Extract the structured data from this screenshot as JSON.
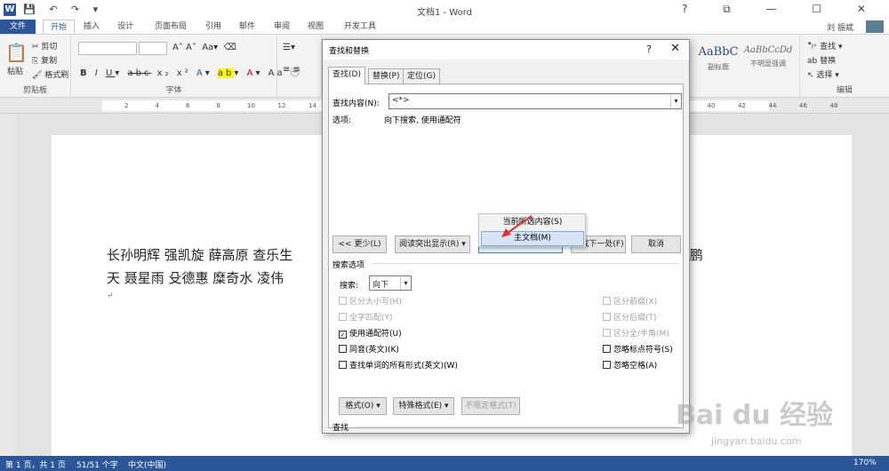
{
  "titlebar": {
    "title": "文档1 - Word",
    "app_icon": "W",
    "quick_access": [
      "save-icon",
      "undo-icon",
      "redo-icon",
      "customize-icon"
    ],
    "window_controls": [
      "?",
      "⧉",
      "—",
      "☐",
      "✕"
    ]
  },
  "tabs": [
    "文件",
    "开始",
    "插入",
    "设计",
    "页面布局",
    "引用",
    "邮件",
    "审阅",
    "视图",
    "开发工具"
  ],
  "user_name": "刘 振斌",
  "ribbon": {
    "clipboard": {
      "paste": "粘贴",
      "cut": "剪切",
      "copy": "复制",
      "format_painter": "格式刷",
      "label": "剪贴板"
    },
    "font": {
      "label": "字体",
      "buttons": [
        "B",
        "I",
        "U",
        "abc",
        "x₂",
        "x²",
        "A",
        "A",
        "Aa",
        "wén",
        "A"
      ]
    },
    "styles": [
      {
        "sample": "AaBbC",
        "name": "副标题"
      },
      {
        "sample": "AaBbCcDd",
        "name": "不明显强调"
      }
    ],
    "editing": {
      "find": "查找",
      "replace": "替换",
      "select": "选择",
      "label": "编辑"
    }
  },
  "ruler_ticks": [
    "2",
    "4",
    "6",
    "8",
    "10",
    "12",
    "14",
    "16",
    "18",
    "20",
    "22",
    "24",
    "26",
    "28",
    "30",
    "32",
    "34",
    "36",
    "38",
    "40",
    "42",
    "44",
    "46",
    "48"
  ],
  "document": {
    "line1": "长孙明辉 强凯旋 薛高原 查乐生",
    "line1_tail": "傅 鹏",
    "line2": "天 聂星雨 殳德惠 糜奇水 凌伟"
  },
  "dialog": {
    "title": "查找和替换",
    "tabs": [
      "查找(D)",
      "替换(P)",
      "定位(G)"
    ],
    "find_label": "查找内容(N):",
    "find_value": "<*>",
    "options_label": "选项:",
    "options_value": "向下搜索, 使用通配符",
    "buttons": {
      "less": "<< 更少(L)",
      "reading_highlight": "阅读突出显示(R) ▾",
      "find_in": "在以下项中查找(I) ▾",
      "find_next": "查找下一处(F)",
      "cancel": "取消"
    },
    "menu": [
      "当前所选内容(S)",
      "主文档(M)"
    ],
    "search_options_label": "搜索选项",
    "search_label": "搜索:",
    "search_value": "向下",
    "left_options": [
      {
        "label": "区分大小写(H)",
        "checked": false,
        "disabled": true
      },
      {
        "label": "全字匹配(Y)",
        "checked": false,
        "disabled": true
      },
      {
        "label": "使用通配符(U)",
        "checked": true,
        "disabled": false
      },
      {
        "label": "同音(英文)(K)",
        "checked": false,
        "disabled": false
      },
      {
        "label": "查找单词的所有形式(英文)(W)",
        "checked": false,
        "disabled": false
      }
    ],
    "right_options": [
      {
        "label": "区分前缀(X)",
        "checked": false,
        "disabled": true
      },
      {
        "label": "区分后缀(T)",
        "checked": false,
        "disabled": true
      },
      {
        "label": "区分全/半角(M)",
        "checked": false,
        "disabled": true
      },
      {
        "label": "忽略标点符号(S)",
        "checked": false,
        "disabled": false
      },
      {
        "label": "忽略空格(A)",
        "checked": false,
        "disabled": false
      }
    ],
    "find_section_label": "查找",
    "bottom_buttons": [
      "格式(O) ▾",
      "特殊格式(E) ▾",
      "不限定格式(T)"
    ]
  },
  "statusbar": {
    "page": "第 1 页，共 1 页",
    "words": "51/51 个字",
    "language": "中文(中国)",
    "zoom": "170%"
  },
  "watermark": {
    "text": "Bai du 经验",
    "url": "jingyan.baidu.com"
  }
}
